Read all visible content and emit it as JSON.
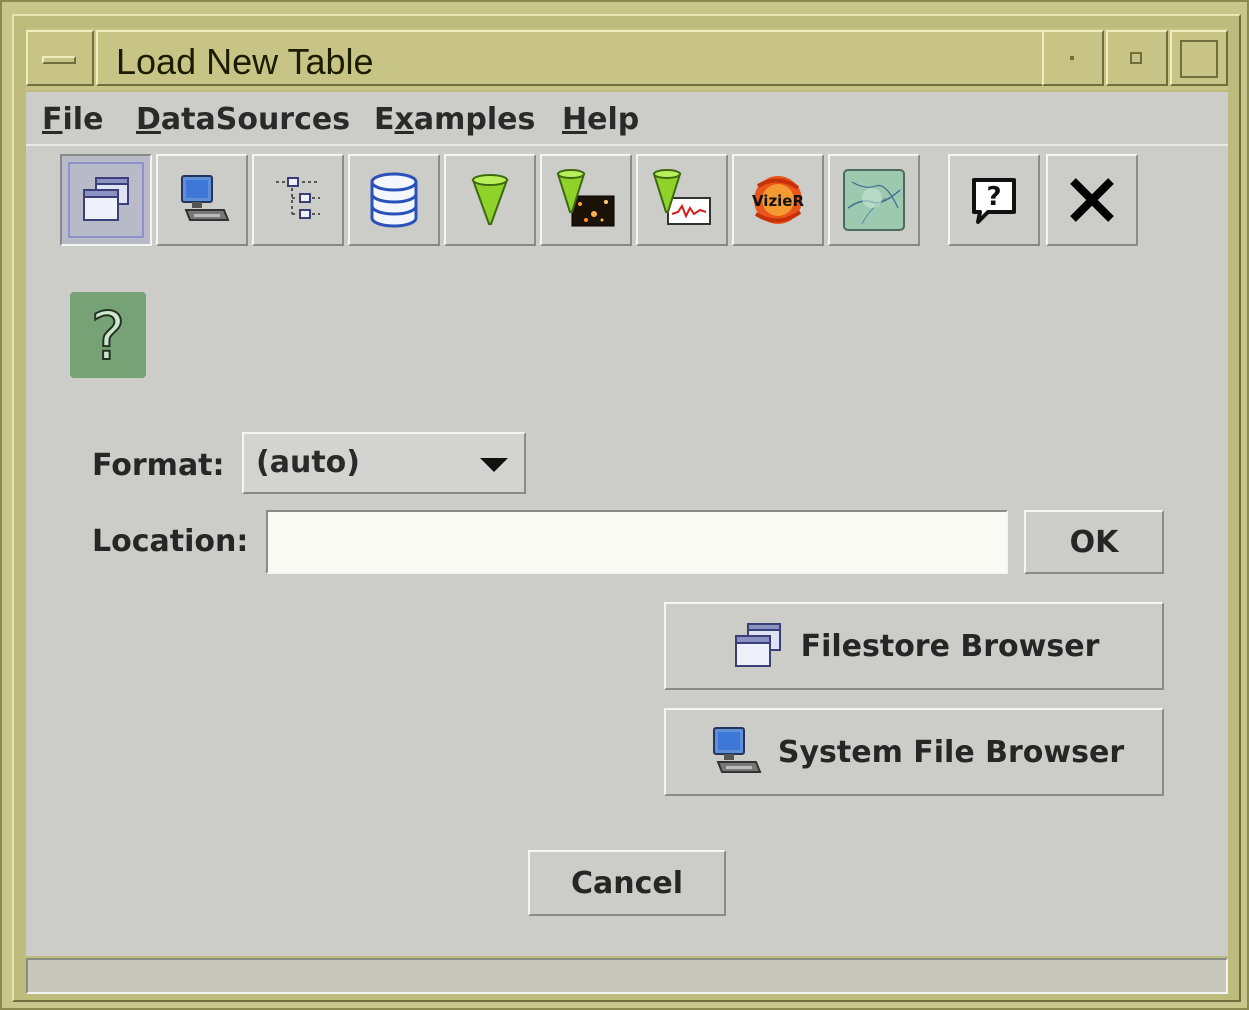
{
  "window": {
    "title": "Load New Table"
  },
  "menu": [
    {
      "label": "File",
      "mnemonic": "F",
      "rest": "ile"
    },
    {
      "label": "DataSources",
      "mnemonic": "D",
      "rest": "ataSources"
    },
    {
      "label": "Examples",
      "pre": "E",
      "mnemonic": "x",
      "rest": "amples"
    },
    {
      "label": "Help",
      "mnemonic": "H",
      "rest": "elp"
    }
  ],
  "toolbar": {
    "items": [
      {
        "icon": "filestore-folder-icon",
        "selected": true
      },
      {
        "icon": "system-computer-icon"
      },
      {
        "icon": "tree-hierarchy-icon"
      },
      {
        "icon": "database-icon"
      },
      {
        "icon": "cone-search-icon"
      },
      {
        "icon": "siap-image-cone-icon"
      },
      {
        "icon": "ssap-spectrum-cone-icon"
      },
      {
        "icon": "vizier-icon",
        "text": "VizieR"
      },
      {
        "icon": "sky-map-icon"
      },
      {
        "icon": "help-icon",
        "text": "?"
      },
      {
        "icon": "close-icon"
      }
    ]
  },
  "form": {
    "format_label": "Format:",
    "format_value": "(auto)",
    "location_label": "Location:",
    "location_value": "",
    "ok_label": "OK"
  },
  "buttons": {
    "filestore": "Filestore Browser",
    "system": "System File Browser",
    "cancel": "Cancel"
  },
  "help_glyph": "?",
  "status": ""
}
